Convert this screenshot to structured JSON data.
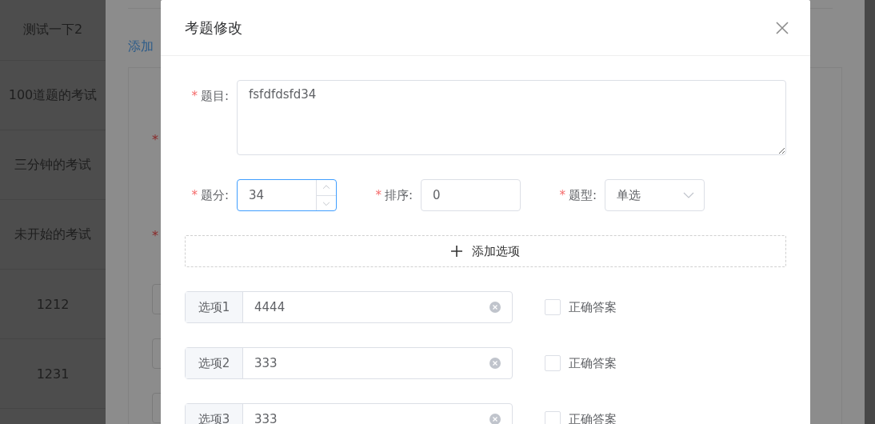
{
  "background": {
    "exam_list": [
      "测试一下2",
      "100道题的考试",
      "三分钟的考试",
      "未开始的考试",
      "1212",
      "1231"
    ],
    "add_link": "添加",
    "required_marks": [
      "*",
      "*"
    ]
  },
  "dialog": {
    "title": "考题修改",
    "question": {
      "label": "题目:",
      "value": "fsfdfdsfd34",
      "required": true
    },
    "fields": [
      {
        "kind": "number",
        "label": "题分:",
        "value": "34",
        "required": true,
        "focused": true
      },
      {
        "kind": "input",
        "label": "排序:",
        "value": "0",
        "required": true,
        "focused": false
      },
      {
        "kind": "select",
        "label": "题型:",
        "value": "单选",
        "required": true,
        "focused": false
      }
    ],
    "add_option_button": "添加选项",
    "options": [
      {
        "label": "选项1",
        "value": "4444",
        "checked": false,
        "answer_label": "正确答案"
      },
      {
        "label": "选项2",
        "value": "333",
        "checked": false,
        "answer_label": "正确答案"
      },
      {
        "label": "选项3",
        "value": "333",
        "checked": false,
        "answer_label": "正确答案"
      }
    ]
  }
}
